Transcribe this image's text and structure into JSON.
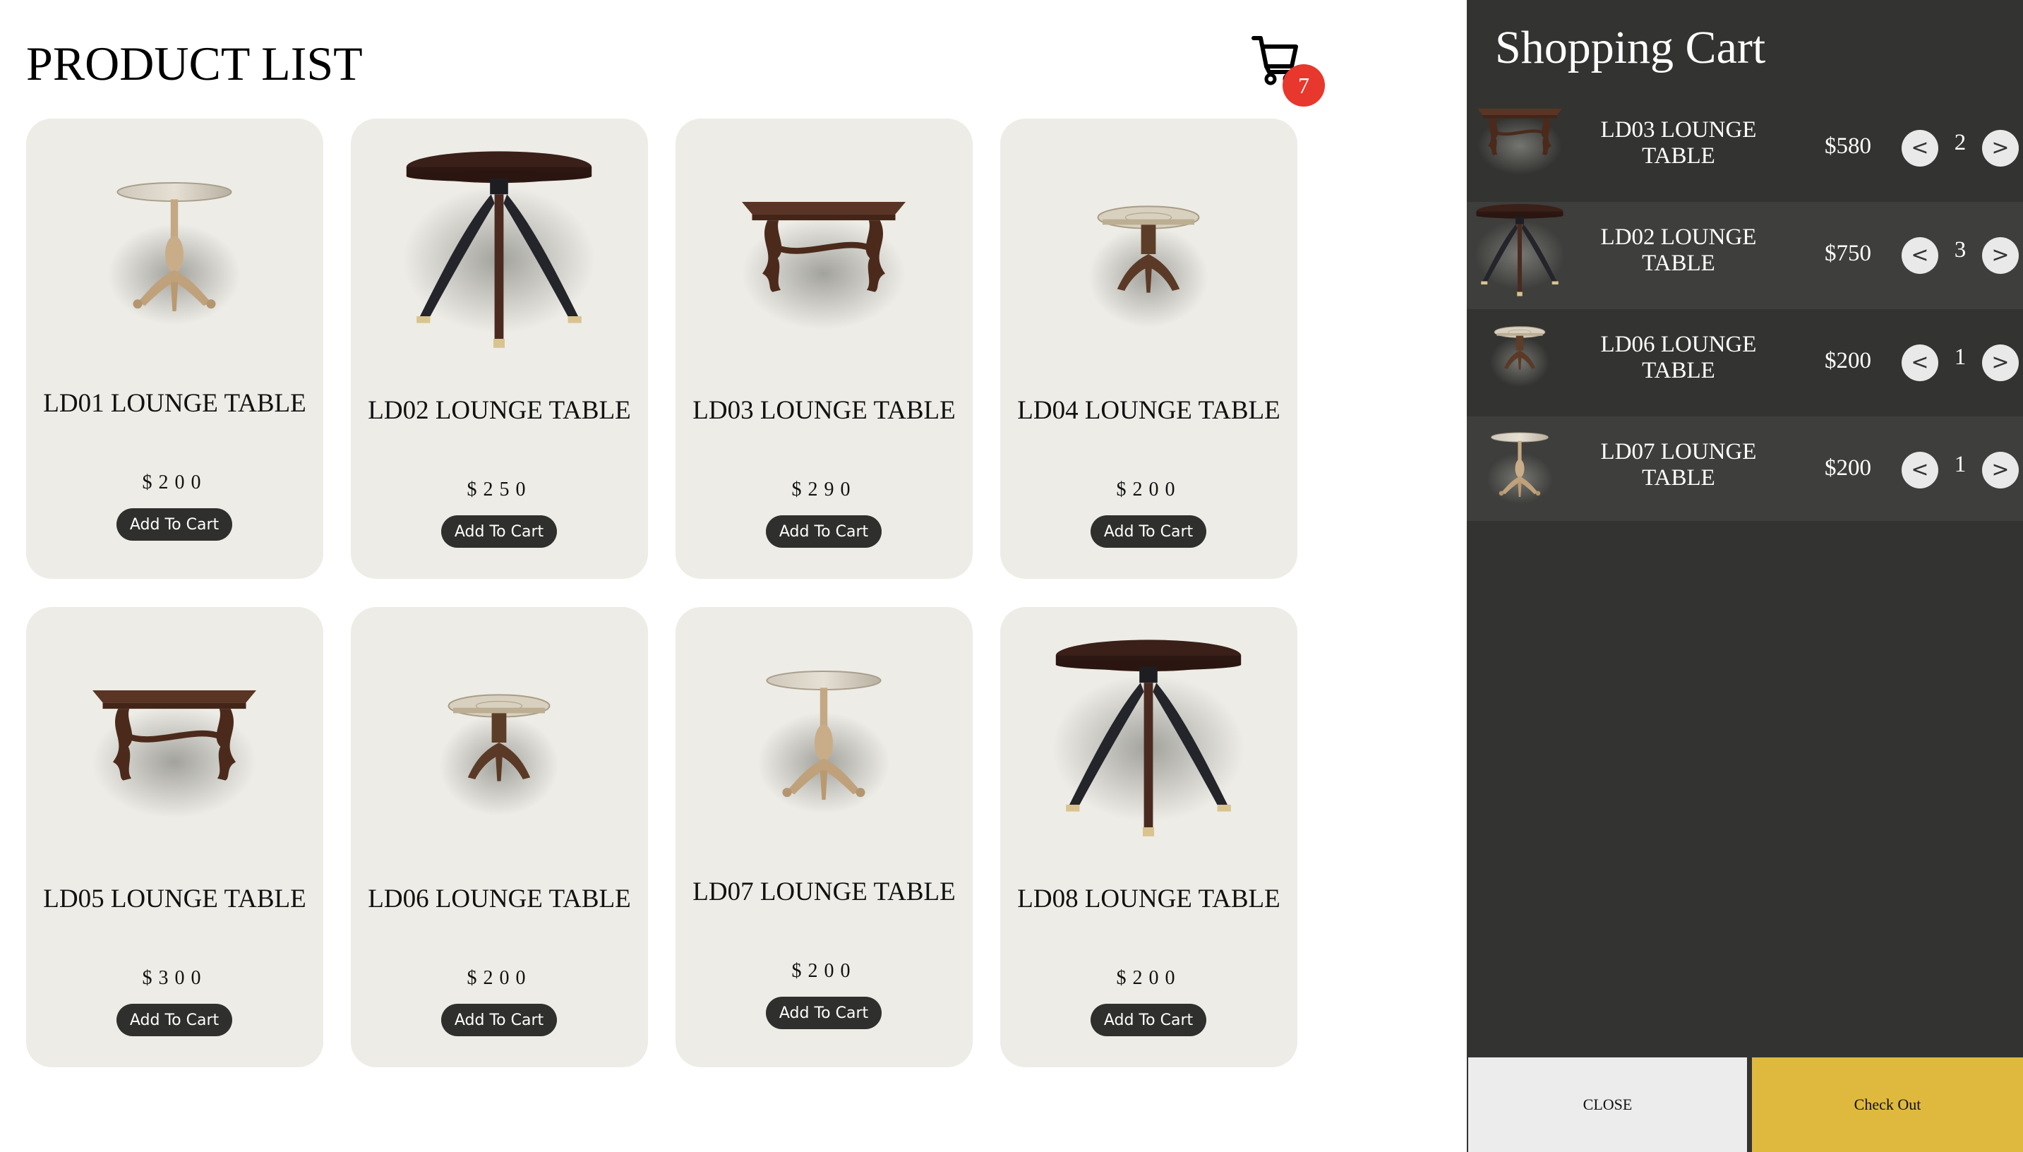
{
  "page": {
    "title": "PRODUCT LIST"
  },
  "cart_icon": {
    "icon": "shopping-cart-icon",
    "count": "7",
    "badge_color": "#e8372c"
  },
  "products": [
    {
      "name": "LD01 LOUNGE TABLE",
      "price": "$200",
      "button": "Add To Cart",
      "image": "pedestal-table-light"
    },
    {
      "name": "LD02 LOUNGE TABLE",
      "price": "$250",
      "button": "Add To Cart",
      "image": "round-table-dark"
    },
    {
      "name": "LD03 LOUNGE TABLE",
      "price": "$290",
      "button": "Add To Cart",
      "image": "rect-table-brown"
    },
    {
      "name": "LD04 LOUNGE TABLE",
      "price": "$200",
      "button": "Add To Cart",
      "image": "small-pedestal-table"
    },
    {
      "name": "LD05 LOUNGE TABLE",
      "price": "$300",
      "button": "Add To Cart",
      "image": "rect-table-brown"
    },
    {
      "name": "LD06 LOUNGE TABLE",
      "price": "$200",
      "button": "Add To Cart",
      "image": "small-pedestal-table"
    },
    {
      "name": "LD07 LOUNGE TABLE",
      "price": "$200",
      "button": "Add To Cart",
      "image": "pedestal-table-light"
    },
    {
      "name": "LD08 LOUNGE TABLE",
      "price": "$200",
      "button": "Add To Cart",
      "image": "round-table-dark"
    }
  ],
  "cart": {
    "title": "Shopping Cart",
    "items": [
      {
        "name": "LD03 LOUNGE TABLE",
        "price": "$580",
        "qty": "2",
        "dec": "<",
        "inc": ">",
        "image": "rect-table-brown"
      },
      {
        "name": "LD02 LOUNGE TABLE",
        "price": "$750",
        "qty": "3",
        "dec": "<",
        "inc": ">",
        "image": "round-table-dark"
      },
      {
        "name": "LD06 LOUNGE TABLE",
        "price": "$200",
        "qty": "1",
        "dec": "<",
        "inc": ">",
        "image": "small-pedestal-table"
      },
      {
        "name": "LD07 LOUNGE TABLE",
        "price": "$200",
        "qty": "1",
        "dec": "<",
        "inc": ">",
        "image": "pedestal-table-light"
      }
    ],
    "close_label": "CLOSE",
    "checkout_label": "Check Out"
  },
  "colors": {
    "card_bg": "#edece6",
    "button_dark": "#2f2f2d",
    "panel_bg": "#333331",
    "panel_row_alt": "#3e3e3c",
    "checkout": "#dfb93e",
    "close": "#ececec"
  }
}
